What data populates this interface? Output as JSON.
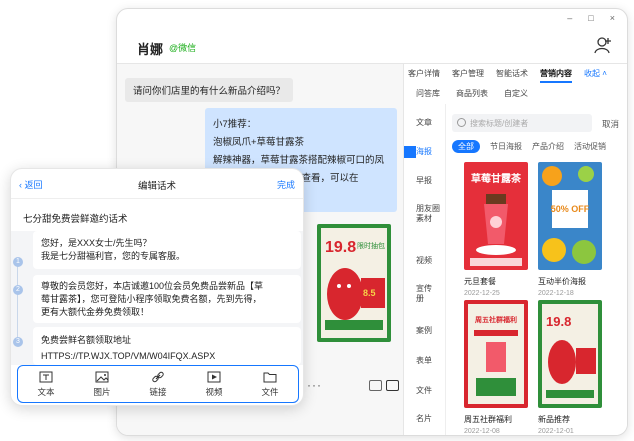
{
  "window": {
    "controls": [
      "–",
      "□",
      "×"
    ],
    "contact": {
      "name": "肖娜",
      "tag": "@微信"
    }
  },
  "chat": {
    "incoming": "请问你们店里的有什么新品介绍吗？",
    "outgoing": {
      "title": "小7推荐：",
      "line1": "泡椒凤爪+草莓甘露茶",
      "line2": "解辣神器，草莓甘露茶搭配辣椒可口的凤",
      "line3": "小程序查看，可以在"
    },
    "more_dots": "···"
  },
  "poster": {
    "top": "19.8",
    "unit": "元",
    "big": "8.5",
    "tag": "限时抽包"
  },
  "right_panel": {
    "tabs_row1": [
      "客户详情",
      "客户管理",
      "智能话术",
      "营销内容",
      "收起"
    ],
    "tabs_row2": [
      "问答库",
      "商品列表",
      "自定义"
    ],
    "side": [
      "文章",
      "海报",
      "早报",
      "朋友圈素材",
      "视频",
      "宣传册",
      "案例",
      "表单",
      "文件",
      "名片"
    ],
    "search_placeholder": "搜索标题/创建者",
    "cancel": "取消",
    "chips": [
      "全部",
      "节日海报",
      "产品介绍",
      "活动促销"
    ],
    "cards": [
      {
        "name": "元旦套餐",
        "date": "2022-12-25",
        "headline": "草莓甘露茶"
      },
      {
        "name": "互动半价海报",
        "date": "2022-12-18",
        "headline": "50% OFF"
      },
      {
        "name": "周五社群福利",
        "date": "2022-12-08",
        "headline": "周五社群福利"
      },
      {
        "name": "新品推荐",
        "date": "2022-12-01",
        "headline": "19.8"
      }
    ]
  },
  "edit_panel": {
    "back": "返回",
    "title": "编辑话术",
    "done": "完成",
    "subject": "七分甜免费尝鲜邀约话术",
    "messages": [
      {
        "num": "1",
        "lines": [
          "您好，是XXX女士/先生吗？",
          "我是七分甜福利官，您的专属客服。"
        ]
      },
      {
        "num": "2",
        "lines": [
          "尊敬的会员您好，本店诚邀100位会员免费品尝新品【草",
          "莓甘露茶】，您可登陆小程序领取免费名额，先到先得，",
          "更有大额代金券免费领取！"
        ]
      },
      {
        "num": "3",
        "lines": [
          "免费尝鲜名额领取地址",
          "HTTPS://TP.WJX.TOP/VM/W04IFQX.ASPX"
        ]
      }
    ],
    "tools": [
      "文本",
      "图片",
      "链接",
      "视频",
      "文件"
    ]
  },
  "colors": {
    "accent": "#1677ff",
    "wechat_green": "#1aad19",
    "poster_red": "#d8262e",
    "poster_green": "#2f8f3a",
    "poster_yellow": "#f7d247"
  }
}
